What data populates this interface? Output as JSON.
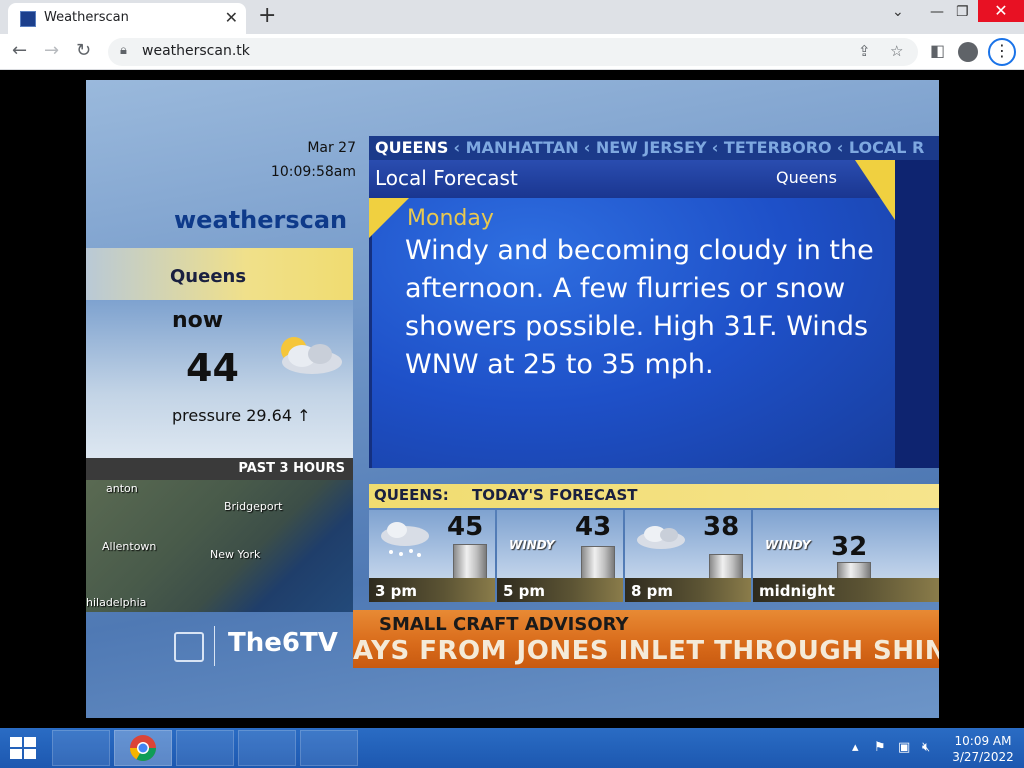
{
  "browser": {
    "tab_title": "Weatherscan",
    "url": "weatherscan.tk",
    "new_tab": "+",
    "tab_close": "✕",
    "minimize": "—",
    "restore": "❐",
    "close": "✕",
    "chevron": "⌄"
  },
  "weatherscan": {
    "date": "Mar 27",
    "time": "10:09:58am",
    "logo": "weatherscan",
    "current": {
      "location": "Queens",
      "label": "now",
      "temperature": "44",
      "pressure": "pressure 29.64 ↑",
      "condition_icon": "partly-cloudy-icon"
    },
    "radar": {
      "label": "PAST 3 HOURS",
      "places": [
        "anton",
        "Bridgeport",
        "Allentown",
        "New York",
        "hiladelphia"
      ]
    },
    "channel_logo": "The6TV",
    "locations": {
      "current": "QUEENS",
      "others": [
        "‹ MANHATTAN",
        "‹ NEW JERSEY",
        "‹ TETERBORO",
        "‹ LOCAL R"
      ]
    },
    "local_forecast": {
      "title": "Local Forecast",
      "location": "Queens",
      "day": "Monday",
      "text": "Windy and becoming cloudy in the afternoon. A few flurries or snow showers possible. High 31F. Winds WNW at 25 to 35 mph."
    },
    "todays_forecast": {
      "location": "QUEENS:",
      "title": "TODAY'S FORECAST",
      "periods": [
        {
          "time": "3 pm",
          "temp": "45",
          "icon": "snow-cloud-icon",
          "label": ""
        },
        {
          "time": "5 pm",
          "temp": "43",
          "icon": "windy-icon",
          "label": "WINDY"
        },
        {
          "time": "8 pm",
          "temp": "38",
          "icon": "cloud-icon",
          "label": ""
        },
        {
          "time": "midnight",
          "temp": "32",
          "icon": "windy-icon",
          "label": "WINDY"
        }
      ]
    },
    "advisory": {
      "title": "SMALL CRAFT ADVISORY",
      "text": "AYS FROM JONES INLET THROUGH SHINN"
    }
  },
  "taskbar": {
    "time": "10:09 AM",
    "date": "3/27/2022",
    "tray_up": "▴"
  },
  "colors": {
    "accent": "#1a73e8",
    "close_red": "#e81123",
    "forecast_blue": "#1e50c8",
    "advisory_orange": "#d86a1a",
    "yellow": "#f0dc70"
  }
}
